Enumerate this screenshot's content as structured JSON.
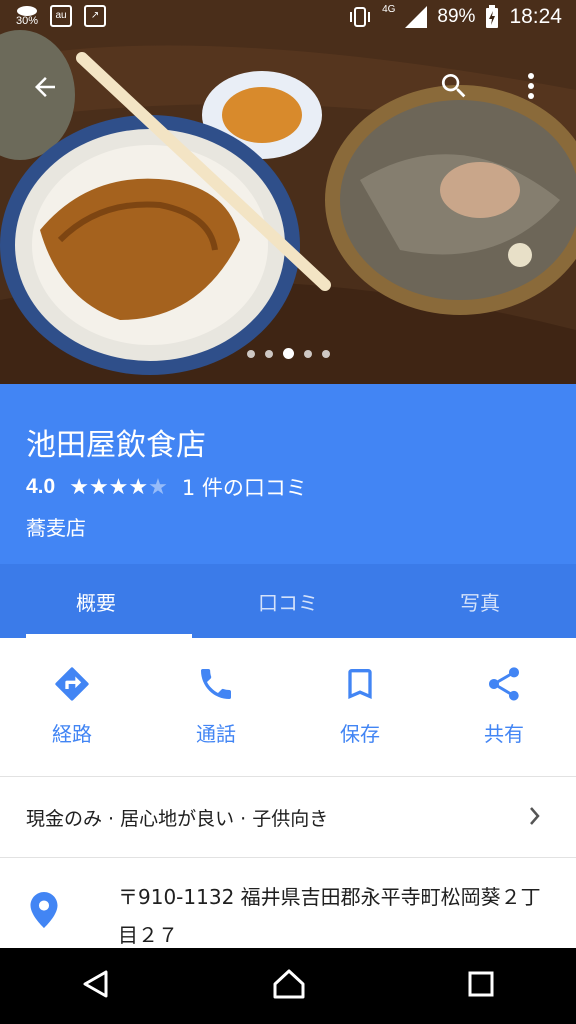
{
  "status_bar": {
    "left_percent": "30%",
    "network": "4G",
    "battery": "89%",
    "time": "18:24"
  },
  "photo": {
    "indicator_count": 5,
    "active_index": 2
  },
  "place": {
    "name": "池田屋飲食店",
    "rating": "4.0",
    "stars": 4,
    "reviews": "1 件の口コミ",
    "category": "蕎麦店"
  },
  "tabs": [
    {
      "label": "概要",
      "active": true
    },
    {
      "label": "口コミ",
      "active": false
    },
    {
      "label": "写真",
      "active": false
    }
  ],
  "actions": [
    {
      "label": "経路",
      "icon": "directions-icon"
    },
    {
      "label": "通話",
      "icon": "phone-icon"
    },
    {
      "label": "保存",
      "icon": "bookmark-icon"
    },
    {
      "label": "共有",
      "icon": "share-icon"
    }
  ],
  "attributes": "現金のみ · 居心地が良い · 子供向き",
  "address": "〒910-1132 福井県吉田郡永平寺町松岡葵２丁目２７",
  "colors": {
    "header": "#4285f4",
    "tabs": "#3b7be9",
    "accent": "#4285f4"
  }
}
